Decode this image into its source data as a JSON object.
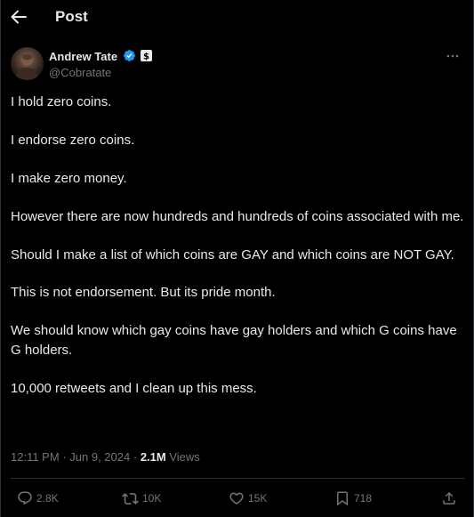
{
  "header": {
    "title": "Post"
  },
  "author": {
    "name": "Andrew Tate",
    "handle": "@Cobratate",
    "verified_icon": "verified-badge-icon",
    "affiliation_icon": "affiliation-badge-icon"
  },
  "tweet": {
    "paragraphs": [
      "I hold zero coins.",
      "I endorse zero coins.",
      "I make zero money.",
      "However there are now hundreds and hundreds of coins associated with me.",
      "Should I make a list of which coins are GAY and which coins are NOT GAY.",
      "This is not endorsement. But its pride month.",
      "We should know which gay coins have gay holders and which G coins have G holders.",
      "10,000 retweets and I clean up this mess."
    ],
    "time": "12:11 PM",
    "separator": "·",
    "date": "Jun 9, 2024",
    "views_count": "2.1M",
    "views_label": "Views"
  },
  "actions": {
    "replies": "2.8K",
    "reposts": "10K",
    "likes": "15K",
    "bookmarks": "718"
  },
  "colors": {
    "background": "#000000",
    "text": "#e7e9ea",
    "muted": "#71767b",
    "border": "#2f3336",
    "verified": "#1d9bf0"
  }
}
